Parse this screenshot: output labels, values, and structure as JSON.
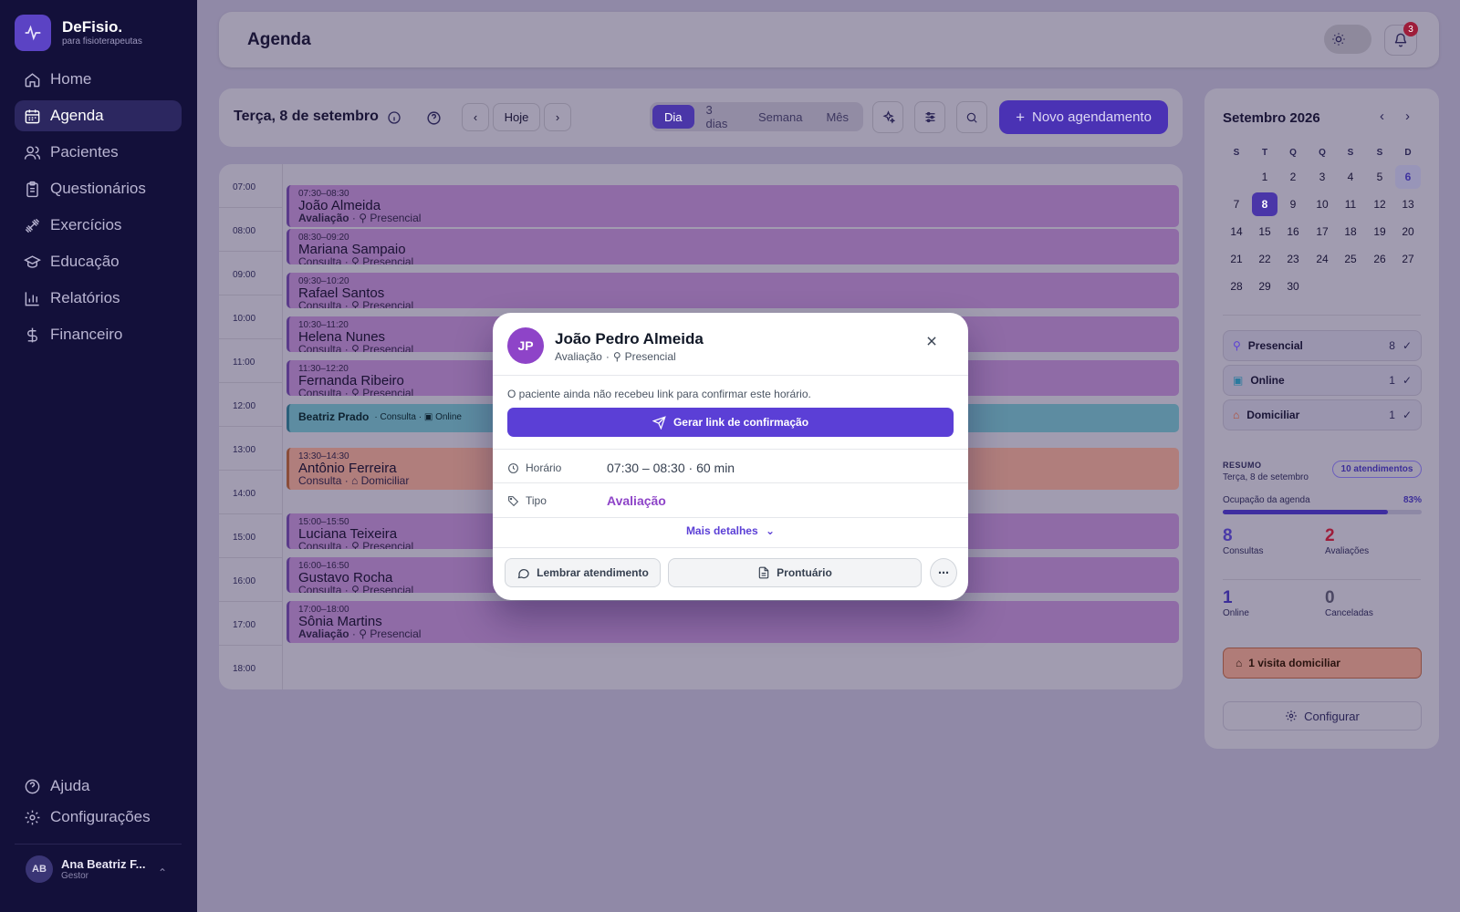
{
  "app": {
    "name": "DeFisio.",
    "tagline": "para fisioterapeutas"
  },
  "sidebar": {
    "items": [
      {
        "label": "Home",
        "icon": "home-icon"
      },
      {
        "label": "Agenda",
        "icon": "calendar-icon",
        "active": true
      },
      {
        "label": "Pacientes",
        "icon": "users-icon"
      },
      {
        "label": "Questionários",
        "icon": "clipboard-icon"
      },
      {
        "label": "Exercícios",
        "icon": "dumbbell-icon"
      },
      {
        "label": "Educação",
        "icon": "graduation-icon"
      },
      {
        "label": "Relatórios",
        "icon": "bar-chart-icon"
      },
      {
        "label": "Financeiro",
        "icon": "dollar-icon"
      }
    ],
    "bottom": [
      {
        "label": "Ajuda",
        "icon": "help-icon"
      },
      {
        "label": "Configurações",
        "icon": "gear-icon"
      }
    ],
    "user": {
      "initials": "AB",
      "name": "Ana Beatriz F...",
      "role": "Gestor"
    }
  },
  "header": {
    "title": "Agenda",
    "notifications": "3"
  },
  "toolbar": {
    "date": "Terça, 8 de setembro",
    "today": "Hoje",
    "views": [
      "Dia",
      "3 dias",
      "Semana",
      "Mês"
    ],
    "active_view": "Dia",
    "new_button": "Novo agendamento"
  },
  "schedule": {
    "hours": [
      "07:00",
      "08:00",
      "09:00",
      "10:00",
      "11:00",
      "12:00",
      "13:00",
      "14:00",
      "15:00",
      "16:00",
      "17:00",
      "18:00"
    ],
    "events": [
      {
        "time": "07:30–08:30",
        "name": "João Almeida",
        "type": "Avaliação",
        "mode": "Presencial"
      },
      {
        "time": "08:30–09:20",
        "name": "Mariana Sampaio",
        "type": "Consulta",
        "mode": "Presencial"
      },
      {
        "time": "09:30–10:20",
        "name": "Rafael Santos",
        "type": "Consulta",
        "mode": "Presencial"
      },
      {
        "time": "10:30–11:20",
        "name": "Helena Nunes",
        "type": "Consulta",
        "mode": "Presencial"
      },
      {
        "time": "11:30–12:20",
        "name": "Fernanda Ribeiro",
        "type": "Consulta",
        "mode": "Presencial"
      },
      {
        "time": "",
        "name": "Beatriz Prado",
        "type": "Consulta",
        "mode": "Online"
      },
      {
        "time": "13:30–14:30",
        "name": "Antônio Ferreira",
        "type": "Consulta",
        "mode": "Domiciliar"
      },
      {
        "time": "15:00–15:50",
        "name": "Luciana Teixeira",
        "type": "Consulta",
        "mode": "Presencial"
      },
      {
        "time": "16:00–16:50",
        "name": "Gustavo Rocha",
        "type": "Consulta",
        "mode": "Presencial"
      },
      {
        "time": "17:00–18:00",
        "name": "Sônia Martins",
        "type": "Avaliação",
        "mode": "Presencial"
      }
    ]
  },
  "mini_calendar": {
    "title": "Setembro 2026",
    "dow": [
      "S",
      "T",
      "Q",
      "Q",
      "S",
      "S",
      "D"
    ],
    "weeks": [
      [
        "",
        "1",
        "2",
        "3",
        "4",
        "5",
        "6"
      ],
      [
        "7",
        "8",
        "9",
        "10",
        "11",
        "12",
        "13"
      ],
      [
        "14",
        "15",
        "16",
        "17",
        "18",
        "19",
        "20"
      ],
      [
        "21",
        "22",
        "23",
        "24",
        "25",
        "26",
        "27"
      ],
      [
        "28",
        "29",
        "30",
        "",
        "",
        "",
        ""
      ]
    ],
    "selected": "8",
    "highlighted": "6"
  },
  "types": [
    {
      "label": "Presencial",
      "count": "8",
      "icon": "map-pin-icon",
      "color": "#5b3fd6"
    },
    {
      "label": "Online",
      "count": "1",
      "icon": "video-icon",
      "color": "#2b7a9e"
    },
    {
      "label": "Domiciliar",
      "count": "1",
      "icon": "house-icon",
      "color": "#b3492f"
    }
  ],
  "summary": {
    "title": "RESUMO",
    "date": "Terça, 8 de setembro",
    "badge": "10 atendimentos",
    "occupancy_label": "Ocupação da agenda",
    "occupancy_value": "83%",
    "occupancy_fraction": 0.83,
    "stats": [
      {
        "value": "8",
        "label": "Consultas",
        "color": "#4a3aa8"
      },
      {
        "value": "2",
        "label": "Avaliações",
        "color": "#9e1d3a"
      },
      {
        "value": "1",
        "label": "Online",
        "color": "#3c2e99"
      },
      {
        "value": "0",
        "label": "Canceladas",
        "color": "#4b4763"
      }
    ],
    "home_visit": "1 visita domiciliar",
    "configure": "Configurar"
  },
  "modal": {
    "initials": "JP",
    "name": "João Pedro Almeida",
    "type": "Avaliação",
    "mode": "Presencial",
    "notice": "O paciente ainda não recebeu link para confirmar este horário.",
    "generate": "Gerar link de confirmação",
    "time_label": "Horário",
    "time_value": "07:30 – 08:30 · 60 min",
    "type_label": "Tipo",
    "type_value": "Avaliação",
    "more": "Mais detalhes",
    "remind": "Lembrar atendimento",
    "record": "Prontuário"
  }
}
